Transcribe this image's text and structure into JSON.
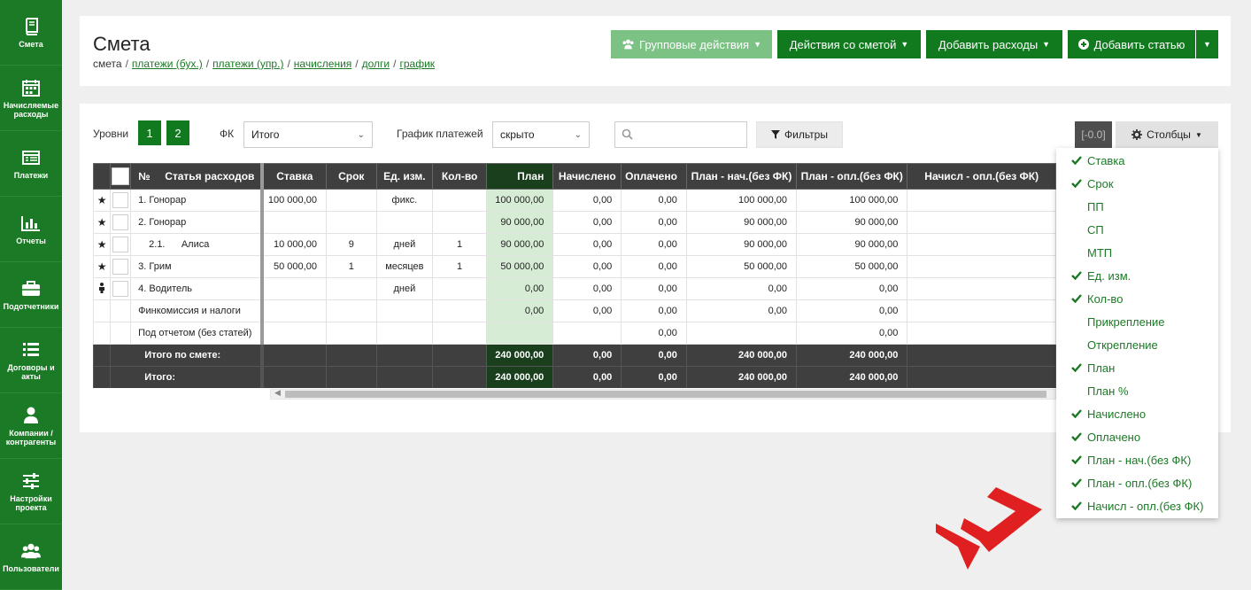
{
  "sidebar": {
    "items": [
      {
        "label": "Смета",
        "icon": "book-icon"
      },
      {
        "label": "Начисляемые расходы",
        "icon": "calendar-icon"
      },
      {
        "label": "Платежи",
        "icon": "list-window-icon"
      },
      {
        "label": "Отчеты",
        "icon": "bar-chart-icon"
      },
      {
        "label": "Подотчетники",
        "icon": "briefcase-icon"
      },
      {
        "label": "Договоры и акты",
        "icon": "list-icon"
      },
      {
        "label": "Компании / контрагенты",
        "icon": "user-icon"
      },
      {
        "label": "Настройки проекта",
        "icon": "sliders-icon"
      },
      {
        "label": "Пользователи",
        "icon": "users-icon"
      }
    ]
  },
  "header": {
    "title": "Смета",
    "breadcrumb": [
      "смета",
      "платежи (бух.)",
      "платежи (упр.)",
      "начисления",
      "долги",
      "график"
    ],
    "buttons": {
      "group_actions": "Групповые действия",
      "estimate_actions": "Действия со сметой",
      "add_expenses": "Добавить расходы",
      "add_item": "Добавить статью"
    }
  },
  "controls": {
    "levels_label": "Уровни",
    "levels": [
      "1",
      "2"
    ],
    "fk_label": "ФК",
    "fk_value": "Итого",
    "schedule_label": "График платежей",
    "schedule_value": "скрыто",
    "search_placeholder": "",
    "filters_label": "Фильтры",
    "range_badge": "[-0.0]",
    "columns_label": "Столбцы"
  },
  "table": {
    "header": {
      "num": "№",
      "item": "Статья расходов",
      "columns": [
        "Ставка",
        "Срок",
        "Ед. изм.",
        "Кол-во",
        "План",
        "Начислено",
        "Оплачено",
        "План - нач.(без ФК)",
        "План - опл.(без ФК)",
        "Начисл - опл.(без ФК)"
      ]
    },
    "rows": [
      {
        "icon": "★",
        "name": "1. Гонорар",
        "rate": "100 000,00",
        "term": "",
        "unit": "фикс.",
        "qty": "",
        "plan": "100 000,00",
        "accrued": "0,00",
        "paid": "0,00",
        "plan_acc": "100 000,00",
        "plan_paid": "100 000,00",
        "acc_paid": ""
      },
      {
        "icon": "★",
        "name": "2. Гонорар",
        "rate": "",
        "term": "",
        "unit": "",
        "qty": "",
        "plan": "90 000,00",
        "accrued": "0,00",
        "paid": "0,00",
        "plan_acc": "90 000,00",
        "plan_paid": "90 000,00",
        "acc_paid": ""
      },
      {
        "icon": "★",
        "name": "2.1.      Алиса",
        "rate": "10 000,00",
        "term": "9",
        "unit": "дней",
        "qty": "1",
        "plan": "90 000,00",
        "accrued": "0,00",
        "paid": "0,00",
        "plan_acc": "90 000,00",
        "plan_paid": "90 000,00",
        "acc_paid": ""
      },
      {
        "icon": "★",
        "name": "3. Грим",
        "rate": "50 000,00",
        "term": "1",
        "unit": "месяцев",
        "qty": "1",
        "plan": "50 000,00",
        "accrued": "0,00",
        "paid": "0,00",
        "plan_acc": "50 000,00",
        "plan_paid": "50 000,00",
        "acc_paid": ""
      },
      {
        "icon": "person",
        "name": "4. Водитель",
        "rate": "",
        "term": "",
        "unit": "дней",
        "qty": "",
        "plan": "0,00",
        "accrued": "0,00",
        "paid": "0,00",
        "plan_acc": "0,00",
        "plan_paid": "0,00",
        "acc_paid": ""
      },
      {
        "icon": "",
        "name": "Финкомиссия и налоги",
        "rate": "",
        "term": "",
        "unit": "",
        "qty": "",
        "plan": "0,00",
        "accrued": "0,00",
        "paid": "0,00",
        "plan_acc": "0,00",
        "plan_paid": "0,00",
        "acc_paid": ""
      },
      {
        "icon": "",
        "name": "Под отчетом (без статей)",
        "rate": "",
        "term": "",
        "unit": "",
        "qty": "",
        "plan": "",
        "accrued": "",
        "paid": "0,00",
        "plan_acc": "",
        "plan_paid": "0,00",
        "acc_paid": ""
      }
    ],
    "totals": [
      {
        "name": "Итого по смете:",
        "plan": "240 000,00",
        "accrued": "0,00",
        "paid": "0,00",
        "plan_acc": "240 000,00",
        "plan_paid": "240 000,00"
      },
      {
        "name": "Итого:",
        "plan": "240 000,00",
        "accrued": "0,00",
        "paid": "0,00",
        "plan_acc": "240 000,00",
        "plan_paid": "240 000,00"
      }
    ]
  },
  "columns_menu": [
    {
      "label": "Ставка",
      "checked": true
    },
    {
      "label": "Срок",
      "checked": true
    },
    {
      "label": "ПП",
      "checked": false
    },
    {
      "label": "СП",
      "checked": false
    },
    {
      "label": "МТП",
      "checked": false
    },
    {
      "label": "Ед. изм.",
      "checked": true
    },
    {
      "label": "Кол-во",
      "checked": true
    },
    {
      "label": "Прикрепление",
      "checked": false
    },
    {
      "label": "Открепление",
      "checked": false
    },
    {
      "label": "План",
      "checked": true
    },
    {
      "label": "План %",
      "checked": false
    },
    {
      "label": "Начислено",
      "checked": true
    },
    {
      "label": "Оплачено",
      "checked": true
    },
    {
      "label": "План - нач.(без ФК)",
      "checked": true
    },
    {
      "label": "План - опл.(без ФК)",
      "checked": true
    },
    {
      "label": "Начисл - опл.(без ФК)",
      "checked": true
    }
  ],
  "colors": {
    "brand_green": "#117a1f",
    "sidebar_green": "#1b7a25",
    "light_green": "#7cc284",
    "plan_bg": "#d6ecd5",
    "logo_red": "#e02020"
  }
}
